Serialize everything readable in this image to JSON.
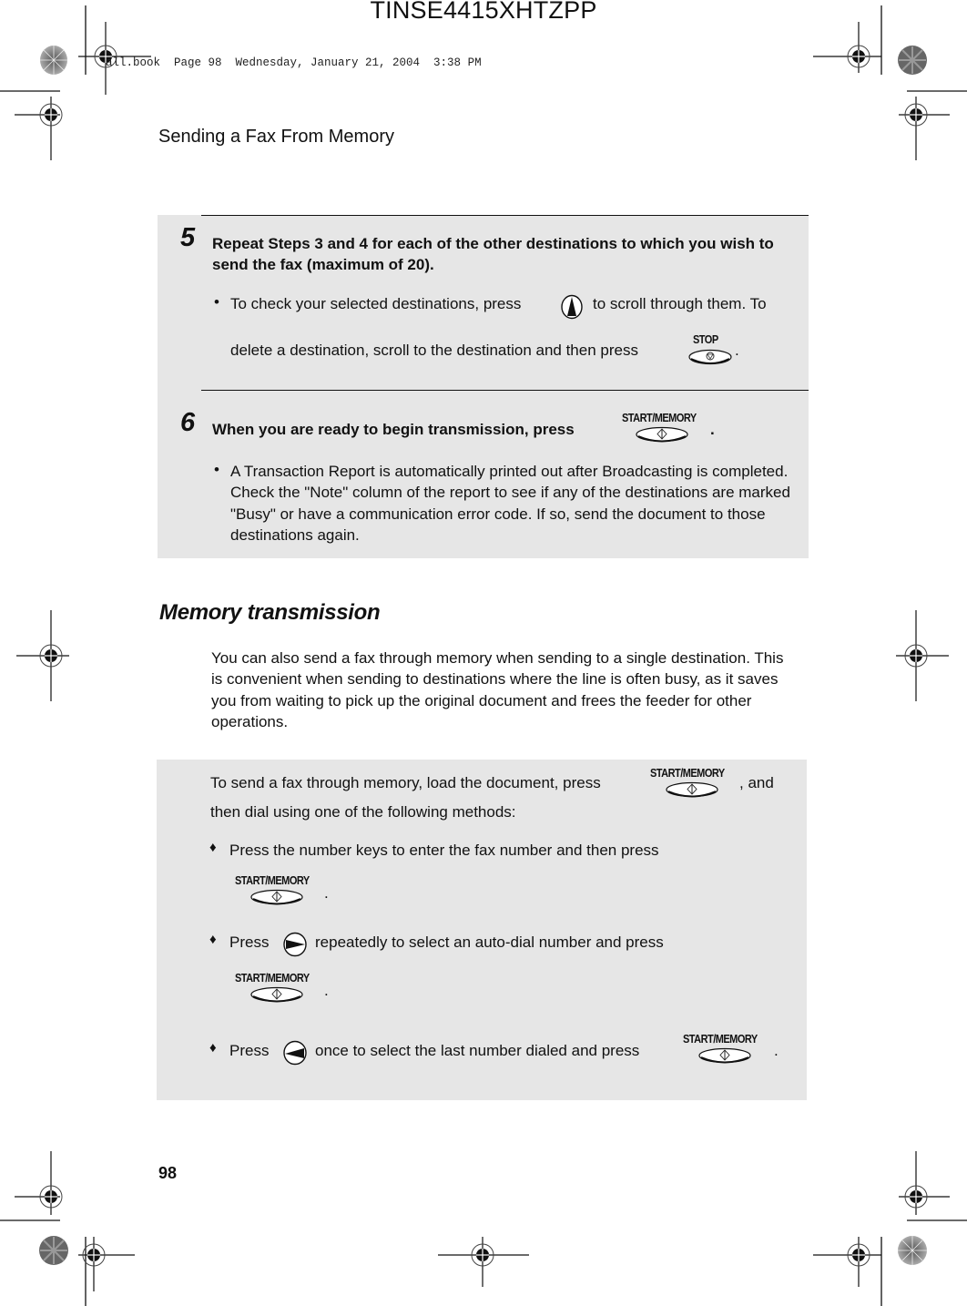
{
  "print_marks": {
    "job_id": "TINSE4415XHTZPP",
    "book_line": "all.book  Page 98  Wednesday, January 21, 2004  3:38 PM"
  },
  "header": {
    "running_head": "Sending a Fax From Memory"
  },
  "steps_box": {
    "steps": [
      {
        "number": "5",
        "heading": "Repeat Steps 3 and 4 for each of the other destinations to which you wish to send the fax (maximum of 20).",
        "bullet_parts": {
          "a": "To check your selected destinations, press",
          "b": "to scroll through them. To",
          "c": "delete a destination, scroll to the destination and then press",
          "d": "."
        }
      },
      {
        "number": "6",
        "heading": "When you are ready to begin transmission, press",
        "heading_end": ".",
        "bullet": "A Transaction Report is automatically printed out after Broadcasting is completed. Check the \"Note\" column of the report to see if any of the destinations are marked \"Busy\" or have a communication error code. If so, send the document to those destinations again."
      }
    ]
  },
  "keys": {
    "stop": "STOP",
    "start_memory": "START/MEMORY",
    "up_arrow": "up-arrow-key",
    "right_arrow": "right-arrow-key",
    "left_arrow": "left-arrow-key"
  },
  "memory_section": {
    "title": "Memory transmission",
    "intro": "You can also send a fax through memory when sending to a single destination. This is convenient when sending to destinations where the line is often busy, as it saves you from waiting to pick up the original document and frees the feeder for other operations."
  },
  "methods_box": {
    "lead_a": "To send a fax through memory, load the document, press",
    "lead_b": ", and",
    "lead_c": "then dial using one of the following methods:",
    "methods": [
      {
        "text": "Press the number keys to enter the fax number and then press",
        "end": "."
      },
      {
        "text_a": "Press",
        "text_b": "repeatedly to select an auto-dial number and press",
        "end": "."
      },
      {
        "text_a": "Press",
        "text_b": "once to select the last number dialed and press",
        "end": "."
      }
    ],
    "bullet_glyph": "♦"
  },
  "footer": {
    "page_number": "98"
  }
}
